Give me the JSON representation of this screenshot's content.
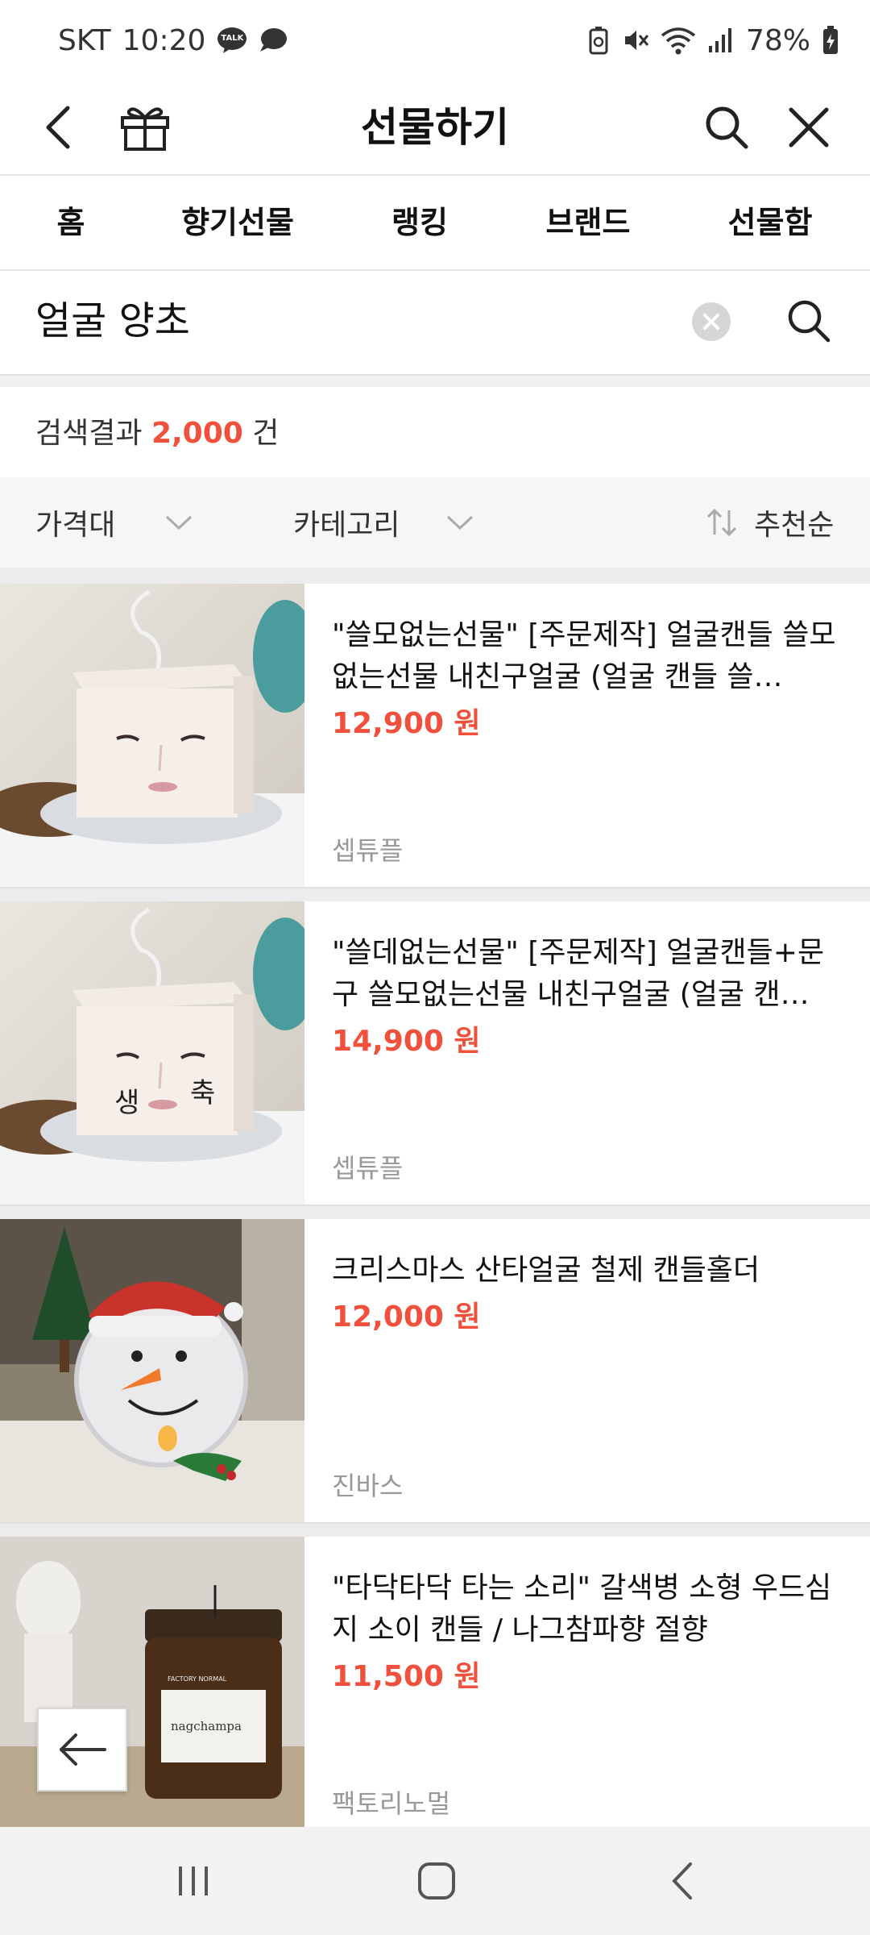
{
  "status_bar": {
    "carrier": "SKT",
    "time": "10:20",
    "talk_badge": "TALK",
    "battery": "78%"
  },
  "header": {
    "title": "선물하기"
  },
  "tabs": [
    {
      "label": "홈"
    },
    {
      "label": "향기선물",
      "has_dot": true
    },
    {
      "label": "랭킹"
    },
    {
      "label": "브랜드"
    },
    {
      "label": "선물함"
    }
  ],
  "search": {
    "value": "얼굴 양초"
  },
  "result": {
    "prefix": "검색결과",
    "count": "2,000",
    "suffix": "건"
  },
  "filters": {
    "price": "가격대",
    "category": "카테고리",
    "sort": "추천순"
  },
  "products": [
    {
      "title": "\"쓸모없는선물\" [주문제작] 얼굴캔들 쓸모없는선물 내친구얼굴 (얼굴 캔들 쓸…",
      "price": "12,900 원",
      "seller": "셉튜플",
      "image_icon": "face-candle-image"
    },
    {
      "title": "\"쓸데없는선물\" [주문제작] 얼굴캔들+문구 쓸모없는선물 내친구얼굴 (얼굴 캔…",
      "price": "14,900 원",
      "seller": "셉튜플",
      "image_icon": "face-candle-text-image",
      "image_text_left": "생",
      "image_text_right": "축"
    },
    {
      "title": "크리스마스 산타얼굴 철제 캔들홀더",
      "price": "12,000 원",
      "seller": "진바스",
      "image_icon": "snowman-candle-holder-image"
    },
    {
      "title": "\"타닥타닥 타는 소리\" 갈색병 소형 우드심지 소이 캔들 / 나그참파향 절향",
      "price": "11,500 원",
      "seller": "팩토리노멀",
      "image_icon": "jar-candle-image",
      "image_label_top": "FACTORY NORMAL",
      "image_label": "nagchampa"
    }
  ],
  "colors": {
    "accent": "#f0503c",
    "muted": "#999999",
    "band": "#ececec"
  }
}
